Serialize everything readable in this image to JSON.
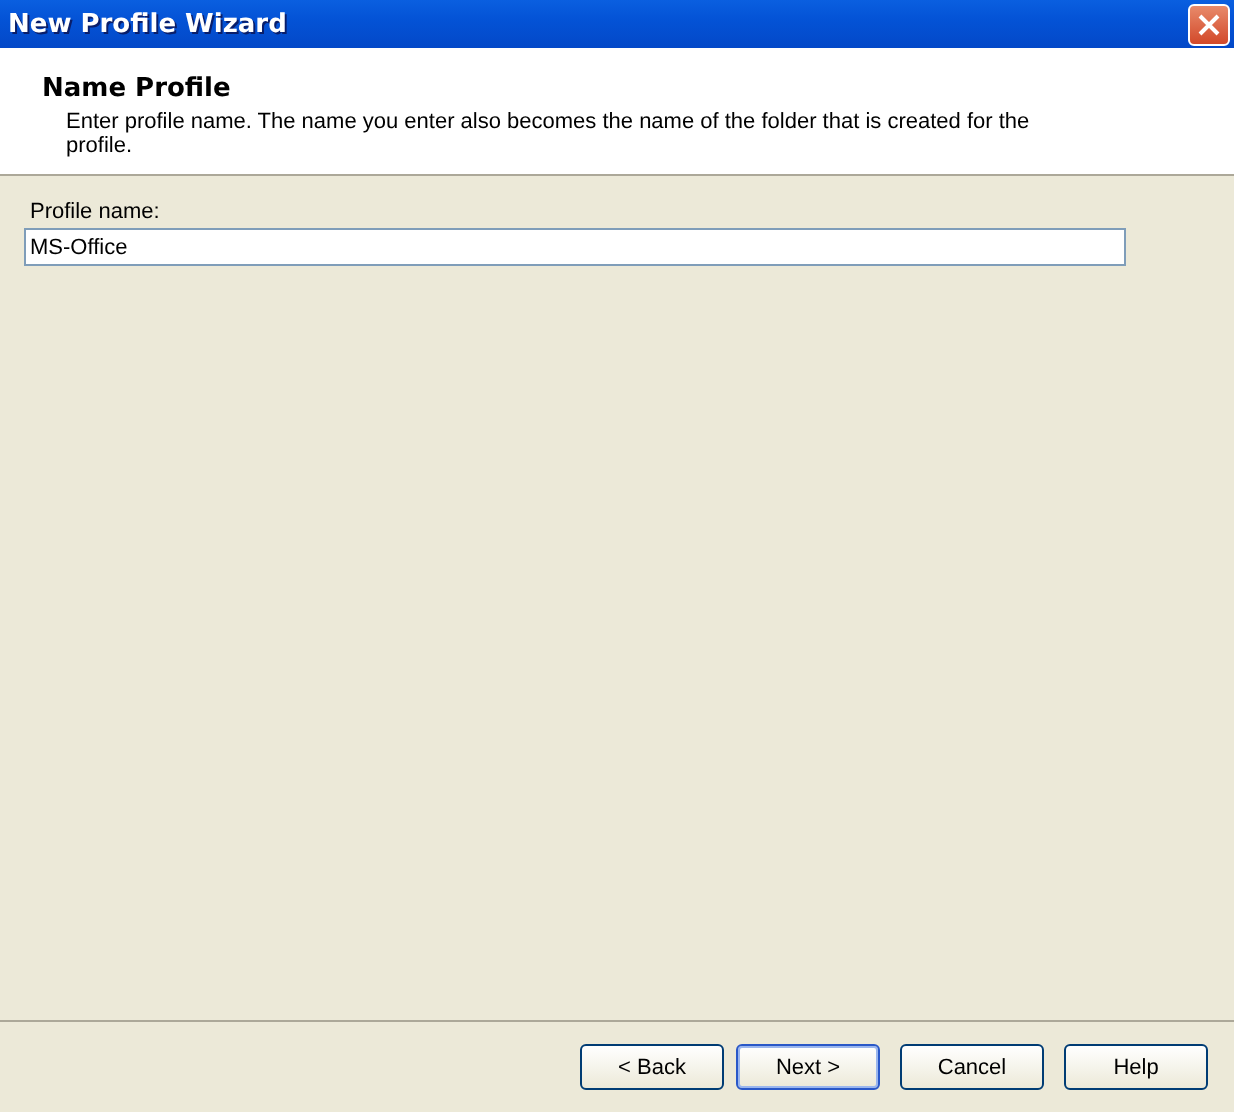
{
  "window": {
    "title": "New Profile Wizard"
  },
  "header": {
    "title": "Name Profile",
    "description": "Enter profile name. The name you enter also becomes the name of the folder that is created for the profile."
  },
  "field": {
    "label": "Profile name:",
    "value": "MS-Office"
  },
  "buttons": [
    {
      "label": "< Back",
      "default": false
    },
    {
      "label": "Next >",
      "default": true
    },
    {
      "label": "Cancel",
      "default": false
    },
    {
      "label": "Help",
      "default": false
    }
  ]
}
